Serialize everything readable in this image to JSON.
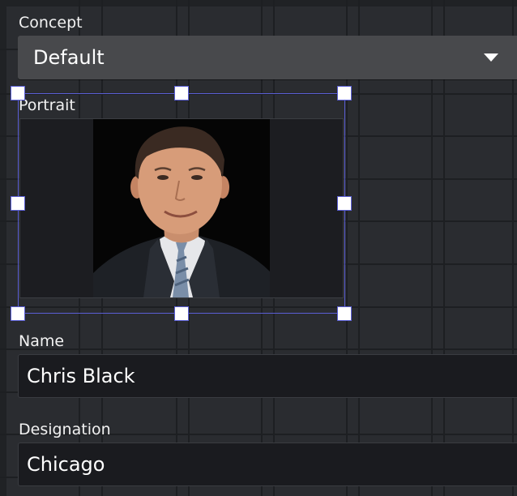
{
  "concept": {
    "label": "Concept",
    "selected": "Default",
    "caret_icon": "caret-down-icon"
  },
  "portrait": {
    "label": "Portrait",
    "image_desc_icon": "portrait-photo"
  },
  "name": {
    "label": "Name",
    "value": "Chris Black"
  },
  "designation": {
    "label": "Designation",
    "value": "Chicago"
  },
  "colors": {
    "background": "#2a2c30",
    "selection": "#5b5fd6",
    "field": "#1a1b1f",
    "dropdown": "#48494c"
  }
}
